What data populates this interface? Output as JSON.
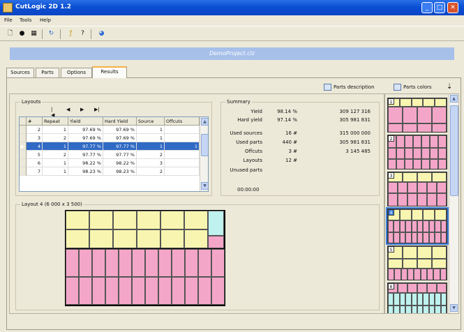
{
  "window": {
    "title": "CutLogic 2D 1.2"
  },
  "colors": {
    "title_bar": "#0a4fd4",
    "banner": "#a7c0ea",
    "selection": "#316ac5",
    "piece_pink": "#f4a6c8",
    "piece_yellow": "#f7f5b0",
    "piece_cyan": "#bff2ee",
    "thumb_highlight": "#3d7fe0"
  },
  "menu": [
    "File",
    "Tools",
    "Help"
  ],
  "toolbar_icons": [
    "new-icon",
    "open-icon",
    "grid-icon",
    "refresh-icon",
    "calculate-icon",
    "help-icon",
    "web-icon"
  ],
  "project_title": "DemoProject.clz",
  "tabs": [
    "Sources",
    "Parts",
    "Options",
    "Results"
  ],
  "active_tab": "Results",
  "parts_tools": {
    "description": "Parts description",
    "colors": "Parts colors"
  },
  "layouts": {
    "legend": "Layouts",
    "nav": [
      "|◀",
      "◀",
      "▶",
      "▶|"
    ],
    "columns": [
      "#",
      "Repeat",
      "Yield",
      "Hard Yield",
      "Source",
      "Offcuts"
    ],
    "rows": [
      [
        "2",
        "1",
        "97.69 %",
        "97.69 %",
        "1",
        ""
      ],
      [
        "3",
        "2",
        "97.69 %",
        "97.69 %",
        "1",
        ""
      ],
      [
        "4",
        "1",
        "97.77 %",
        "97.77 %",
        "1",
        "1"
      ],
      [
        "5",
        "2",
        "97.77 %",
        "97.77 %",
        "2",
        ""
      ],
      [
        "6",
        "1",
        "98.22 %",
        "98.22 %",
        "3",
        ""
      ],
      [
        "7",
        "1",
        "98.23 %",
        "98.23 %",
        "2",
        ""
      ]
    ],
    "selected_index": 2
  },
  "summary": {
    "legend": "Summary",
    "rows": [
      {
        "label": "Yield",
        "value": "98.14 %",
        "extra": "309 127 316"
      },
      {
        "label": "Hard yield",
        "value": "97.14 %",
        "extra": "305 981 831"
      },
      {
        "label": "Used sources",
        "value": "16 #",
        "extra": "315 000 000"
      },
      {
        "label": "Used parts",
        "value": "440 #",
        "extra": "305 981 831"
      },
      {
        "label": "Offcuts",
        "value": "3 #",
        "extra": "3 145 485"
      },
      {
        "label": "Layouts",
        "value": "12 #",
        "extra": ""
      },
      {
        "label": "Unused parts",
        "value": "",
        "extra": ""
      }
    ],
    "time": "00:00:00"
  },
  "layout_view": {
    "legend": "Layout 4 (6 000 x 3 500)"
  },
  "thumbnails": [
    "1",
    "2",
    "3",
    "4",
    "5",
    "6"
  ],
  "selected_thumbnail": 3
}
